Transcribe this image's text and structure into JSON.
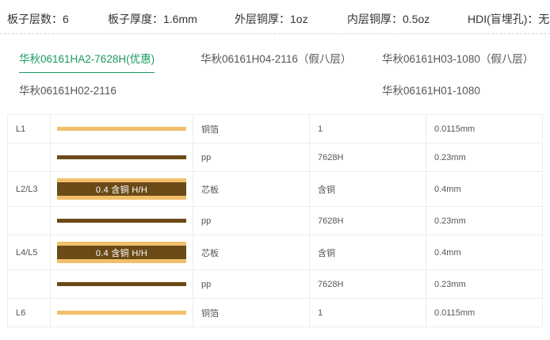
{
  "specs": {
    "layers": "板子层数：6",
    "thickness": "板子厚度：1.6mm",
    "outer_copper": "外层铜厚：1oz",
    "inner_copper": "内层铜厚：0.5oz",
    "hdi": "HDI(盲埋孔)：无"
  },
  "tabs": [
    {
      "label": "华秋06161HA2-7628H(优惠)",
      "active": true
    },
    {
      "label": "华秋06161H04-2116（假八层）",
      "active": false
    },
    {
      "label": "华秋06161H03-1080（假八层）",
      "active": false
    },
    {
      "label": "华秋06161H02-2116",
      "active": false
    },
    {
      "label": "华秋06161H01-1080",
      "active": false
    }
  ],
  "stackup": [
    {
      "layer": "L1",
      "kind": "foil",
      "material": "铜箔",
      "spec": "1",
      "thickness": "0.0115mm"
    },
    {
      "layer": "",
      "kind": "pp",
      "material": "pp",
      "spec": "7628H",
      "thickness": "0.23mm"
    },
    {
      "layer": "L2/L3",
      "kind": "core",
      "core_label": "0.4 含铜 H/H",
      "material": "芯板",
      "spec": "含铜",
      "thickness": "0.4mm"
    },
    {
      "layer": "",
      "kind": "pp",
      "material": "pp",
      "spec": "7628H",
      "thickness": "0.23mm"
    },
    {
      "layer": "L4/L5",
      "kind": "core",
      "core_label": "0.4 含铜 H/H",
      "material": "芯板",
      "spec": "含铜",
      "thickness": "0.4mm"
    },
    {
      "layer": "",
      "kind": "pp",
      "material": "pp",
      "spec": "7628H",
      "thickness": "0.23mm"
    },
    {
      "layer": "L6",
      "kind": "foil",
      "material": "铜箔",
      "spec": "1",
      "thickness": "0.0115mm"
    }
  ],
  "colors": {
    "accent": "#1a9a5c",
    "copper_foil": "#f1bf6a",
    "prepreg": "#6b4a18"
  }
}
